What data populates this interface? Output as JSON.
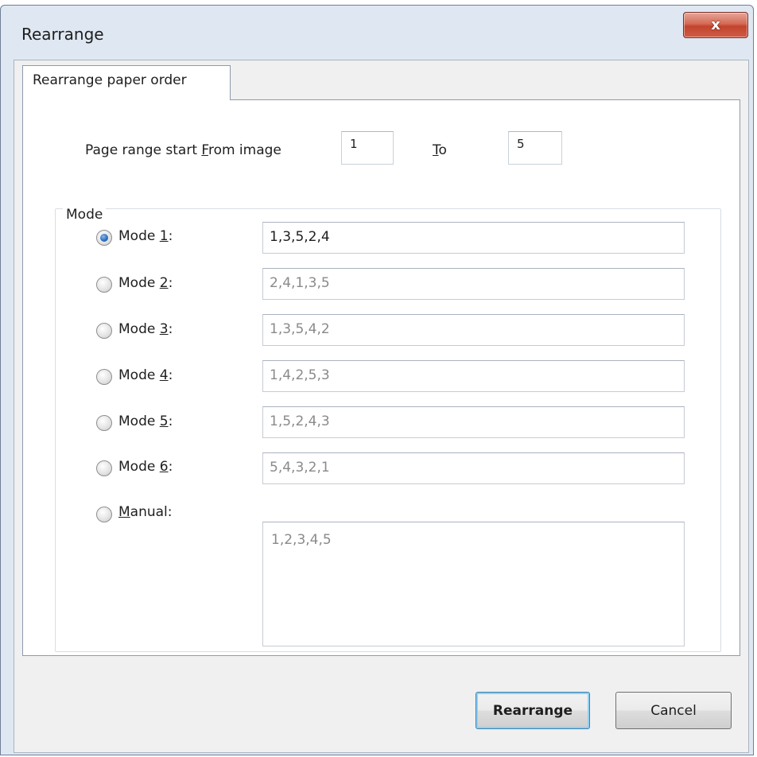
{
  "window": {
    "title": "Rearrange",
    "close_label": "x"
  },
  "tabs": [
    {
      "label": "Rearrange paper order"
    }
  ],
  "page_range": {
    "start_label_before": "Page range start ",
    "start_label_mnemonic": "F",
    "start_label_after": "rom image",
    "from_value": "1",
    "to_label_mnemonic": "T",
    "to_label_after": "o",
    "to_value": "5"
  },
  "mode_group": {
    "legend": "Mode",
    "modes": [
      {
        "label_before": "Mode ",
        "mnemonic": "1",
        "label_after": ":",
        "value": "1,3,5,2,4",
        "selected": true
      },
      {
        "label_before": "Mode ",
        "mnemonic": "2",
        "label_after": ":",
        "value": "2,4,1,3,5",
        "selected": false
      },
      {
        "label_before": "Mode ",
        "mnemonic": "3",
        "label_after": ":",
        "value": "1,3,5,4,2",
        "selected": false
      },
      {
        "label_before": "Mode ",
        "mnemonic": "4",
        "label_after": ":",
        "value": "1,4,2,5,3",
        "selected": false
      },
      {
        "label_before": "Mode ",
        "mnemonic": "5",
        "label_after": ":",
        "value": "1,5,2,4,3",
        "selected": false
      },
      {
        "label_before": "Mode ",
        "mnemonic": "6",
        "label_after": ":",
        "value": "5,4,3,2,1",
        "selected": false
      }
    ],
    "manual": {
      "mnemonic": "M",
      "label_after": "anual:",
      "value": "1,2,3,4,5",
      "selected": false
    }
  },
  "buttons": {
    "rearrange_label": "Rearrange",
    "cancel_label": "Cancel"
  },
  "colors": {
    "accent_radio": "#2f6fc0",
    "default_button_border": "#3c7fb1",
    "close_button": "#c4432d"
  }
}
